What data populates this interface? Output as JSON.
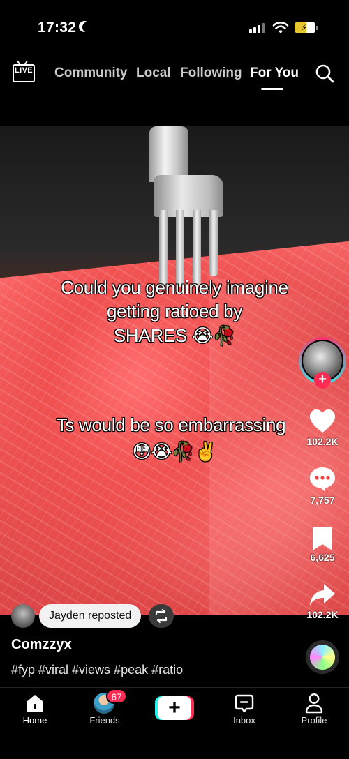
{
  "status_bar": {
    "time": "17:32",
    "battery_state": "charging"
  },
  "top_nav": {
    "live_label": "LIVE",
    "tabs": [
      {
        "label": "Community",
        "active": false
      },
      {
        "label": "Local",
        "active": false
      },
      {
        "label": "Following",
        "active": false
      },
      {
        "label": "For You",
        "active": true
      }
    ],
    "search_icon": "search-icon"
  },
  "video": {
    "overlay_text_1_line1": "Could you genuinely imagine",
    "overlay_text_1_line2": "getting ratioed by",
    "overlay_text_1_line3": "SHARES 😭🥀",
    "overlay_text_2_line1": "Ts would be so embarrassing",
    "overlay_text_2_line2": "😳😭🥀✌️"
  },
  "actions": {
    "follow_plus": "+",
    "likes": "102.2K",
    "comments": "7,757",
    "saves": "6,625",
    "shares": "102.2K"
  },
  "repost": {
    "label": "Jayden reposted"
  },
  "post": {
    "username": "Comzzyx",
    "caption": "#fyp #viral #views #peak #ratio"
  },
  "bottom_nav": {
    "home": "Home",
    "friends": "Friends",
    "friends_badge": "67",
    "create": "+",
    "inbox": "Inbox",
    "profile": "Profile"
  },
  "colors": {
    "accent_red": "#fe2c55",
    "accent_cyan": "#25f4ee",
    "background": "#000000"
  }
}
